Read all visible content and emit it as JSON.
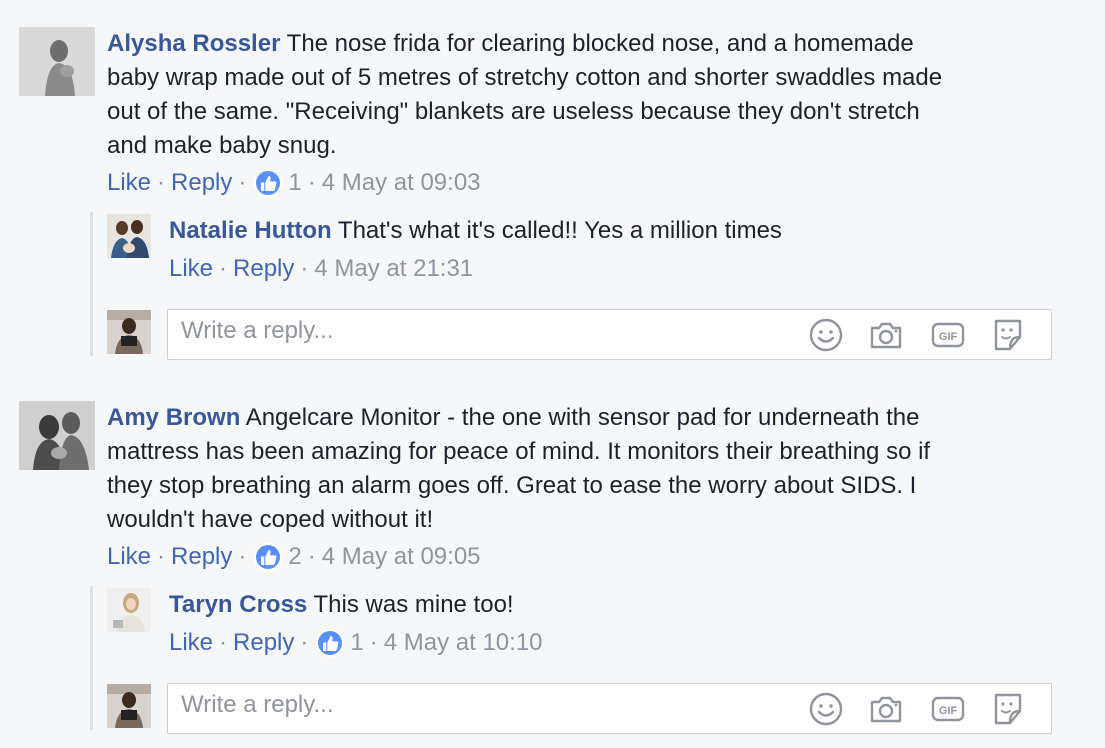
{
  "comments": [
    {
      "author": "Alysha Rossler",
      "lines": [
        "The nose frida for clearing blocked nose, and a homemade",
        "baby wrap made out of 5 metres of stretchy cotton and shorter swaddles made",
        "out of the same. \"Receiving\" blankets are useless because they don't stretch",
        "and make baby snug."
      ],
      "like": "Like",
      "reply": "Reply",
      "reaction_count": "1",
      "time": "4 May at 09:03",
      "replies": [
        {
          "author": "Natalie Hutton",
          "text": "That's what it's called!! Yes a million times",
          "like": "Like",
          "reply": "Reply",
          "time": "4 May at 21:31"
        }
      ],
      "reply_placeholder": "Write a reply..."
    },
    {
      "author": "Amy Brown",
      "lines": [
        "Angelcare Monitor - the one with sensor pad for underneath the",
        "mattress has been amazing for peace of mind. It monitors their breathing so if",
        "they stop breathing an alarm goes off. Great to ease the worry about SIDS. I",
        "wouldn't have coped without it!"
      ],
      "like": "Like",
      "reply": "Reply",
      "reaction_count": "2",
      "time": "4 May at 09:05",
      "replies": [
        {
          "author": "Taryn Cross",
          "text": "This was mine too!",
          "like": "Like",
          "reply": "Reply",
          "reaction_count": "1",
          "time": "4 May at 10:10"
        }
      ],
      "reply_placeholder": "Write a reply..."
    }
  ],
  "separator": "·",
  "reply_box_icons": [
    "emoji-icon",
    "camera-icon",
    "gif-icon",
    "sticker-icon"
  ],
  "gif_label": "GIF",
  "colors": {
    "link": "#385898",
    "meta": "#90949c",
    "like_badge": "#5890ff",
    "background": "#f6f7f9"
  }
}
